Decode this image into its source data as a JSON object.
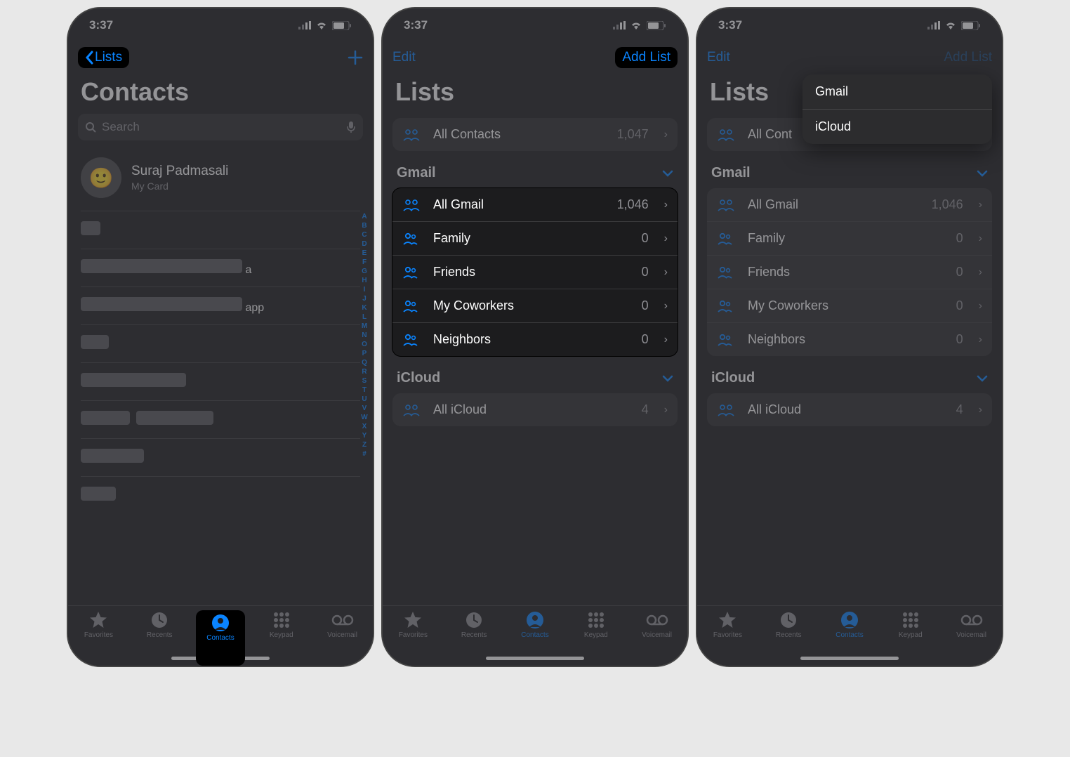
{
  "status": {
    "time": "3:37"
  },
  "screen1": {
    "back_label": "Lists",
    "title": "Contacts",
    "search_placeholder": "Search",
    "my_card": {
      "name": "Suraj Padmasali",
      "sub": "My Card"
    },
    "visible_fragments": [
      "a",
      "app"
    ],
    "index_letters": [
      "A",
      "B",
      "C",
      "D",
      "E",
      "F",
      "G",
      "H",
      "I",
      "J",
      "K",
      "L",
      "M",
      "N",
      "O",
      "P",
      "Q",
      "R",
      "S",
      "T",
      "U",
      "V",
      "W",
      "X",
      "Y",
      "Z",
      "#"
    ]
  },
  "screen2": {
    "edit_label": "Edit",
    "add_list_label": "Add List",
    "title": "Lists",
    "all_contacts": {
      "label": "All Contacts",
      "count": "1,047"
    },
    "gmail_header": "Gmail",
    "gmail_lists": [
      {
        "label": "All Gmail",
        "count": "1,046",
        "all": true
      },
      {
        "label": "Family",
        "count": "0"
      },
      {
        "label": "Friends",
        "count": "0"
      },
      {
        "label": "My Coworkers",
        "count": "0"
      },
      {
        "label": "Neighbors",
        "count": "0"
      }
    ],
    "icloud_header": "iCloud",
    "icloud_lists": [
      {
        "label": "All iCloud",
        "count": "4",
        "all": true
      }
    ]
  },
  "screen3": {
    "edit_label": "Edit",
    "add_list_label": "Add List",
    "title": "Lists",
    "all_contacts_label": "All Cont",
    "gmail_header": "Gmail",
    "gmail_lists": [
      {
        "label": "All Gmail",
        "count": "1,046",
        "all": true
      },
      {
        "label": "Family",
        "count": "0"
      },
      {
        "label": "Friends",
        "count": "0"
      },
      {
        "label": "My Coworkers",
        "count": "0"
      },
      {
        "label": "Neighbors",
        "count": "0"
      }
    ],
    "icloud_header": "iCloud",
    "icloud_lists": [
      {
        "label": "All iCloud",
        "count": "4",
        "all": true
      }
    ],
    "popup": [
      "Gmail",
      "iCloud"
    ]
  },
  "tabs": [
    {
      "id": "favorites",
      "label": "Favorites"
    },
    {
      "id": "recents",
      "label": "Recents"
    },
    {
      "id": "contacts",
      "label": "Contacts"
    },
    {
      "id": "keypad",
      "label": "Keypad"
    },
    {
      "id": "voicemail",
      "label": "Voicemail"
    }
  ]
}
